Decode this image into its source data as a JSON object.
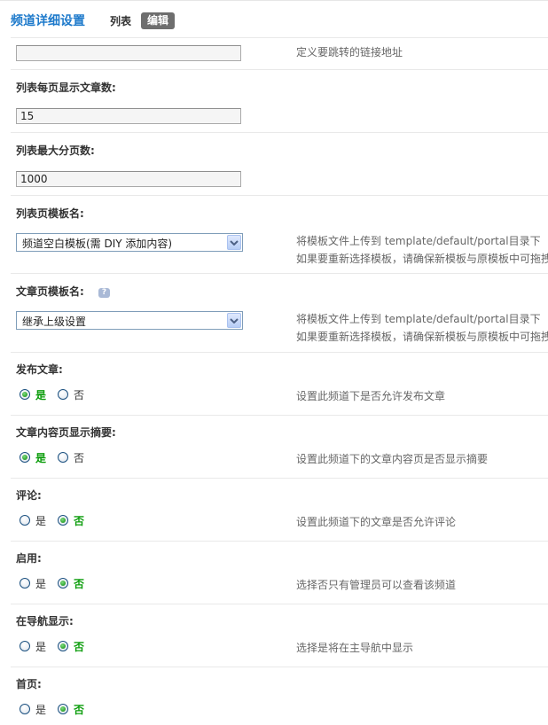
{
  "header": {
    "title": "频道详细设置",
    "tab_list": "列表",
    "tab_edit": "编辑"
  },
  "fields": {
    "link": {
      "value": "",
      "desc": "定义要跳转的链接地址"
    },
    "per_page": {
      "label": "列表每页显示文章数:",
      "value": "15"
    },
    "max_pages": {
      "label": "列表最大分页数:",
      "value": "1000"
    },
    "list_tpl": {
      "label": "列表页模板名:",
      "selected": "频道空白模板(需 DIY 添加内容)",
      "desc1": "将模板文件上传到 template/default/portal目录下",
      "desc2": "如果要重新选择模板，请确保新模板与原模板中可拖拽"
    },
    "article_tpl": {
      "label": "文章页模板名:",
      "help": "?",
      "selected": "继承上级设置",
      "desc1": "将模板文件上传到 template/default/portal目录下",
      "desc2": "如果要重新选择模板，请确保新模板与原模板中可拖拽"
    },
    "publish": {
      "label": "发布文章:",
      "yes": "是",
      "no": "否",
      "checked": "yes",
      "desc": "设置此频道下是否允许发布文章"
    },
    "summary": {
      "label": "文章内容页显示摘要:",
      "yes": "是",
      "no": "否",
      "checked": "yes",
      "desc": "设置此频道下的文章内容页是否显示摘要"
    },
    "comment": {
      "label": "评论:",
      "yes": "是",
      "no": "否",
      "checked": "no",
      "desc": "设置此频道下的文章是否允许评论"
    },
    "enable": {
      "label": "启用:",
      "yes": "是",
      "no": "否",
      "checked": "no",
      "desc": "选择否只有管理员可以查看该频道"
    },
    "nav": {
      "label": "在导航显示:",
      "yes": "是",
      "no": "否",
      "checked": "no",
      "desc": "选择是将在主导航中显示"
    },
    "home": {
      "label": "首页:",
      "yes": "是",
      "no": "否",
      "checked": "no"
    }
  },
  "colors": {
    "title": "#1e7acb",
    "checked_text": "#0c9d0c",
    "select_border": "#7f9db9"
  },
  "icons": {
    "dropdown": "chevron-down-icon",
    "help": "help-icon"
  }
}
